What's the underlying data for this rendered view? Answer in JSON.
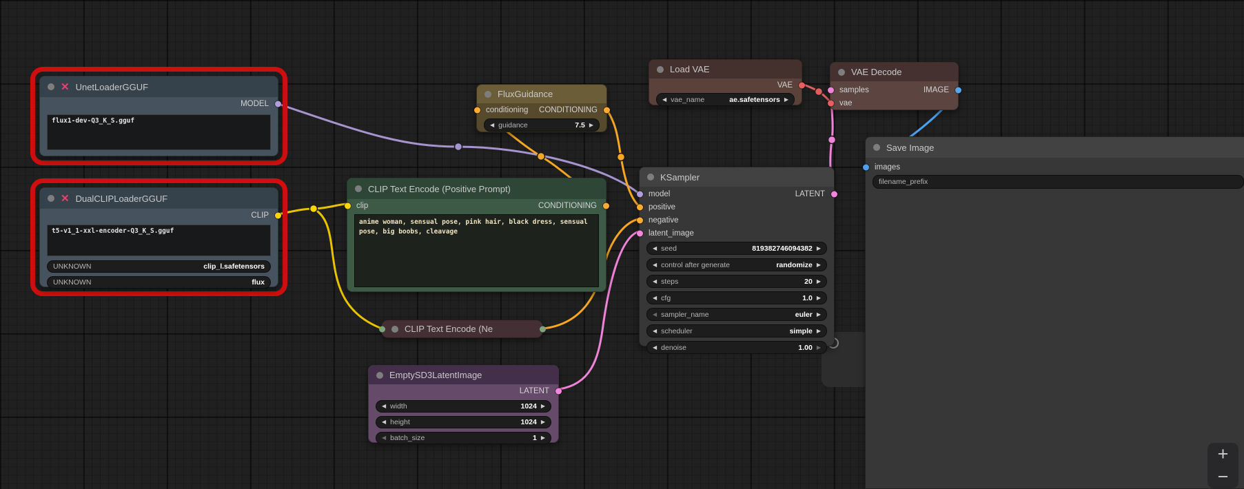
{
  "icons": {
    "left_arrow": "◀",
    "right_arrow": "▶",
    "close_x": "✕",
    "plus": "+",
    "minus": "−"
  },
  "colors": {
    "model": "#b39ddb",
    "clip": "#ffd500",
    "conditioning": "#ffab30",
    "latent": "#f584dd",
    "vae": "#e85f5f",
    "image": "#55a8f0",
    "error_outline": "#cf0f0f"
  },
  "nodes": {
    "unet_loader": {
      "title": "UnetLoaderGGUF",
      "output_label": "MODEL",
      "unet_name": "flux1-dev-Q3_K_S.gguf"
    },
    "dual_clip_loader": {
      "title": "DualCLIPLoaderGGUF",
      "output_label": "CLIP",
      "clip_name": "t5-v1_1-xxl-encoder-Q3_K_S.gguf",
      "widgets": [
        {
          "name": "UNKNOWN",
          "value": "clip_l.safetensors"
        },
        {
          "name": "UNKNOWN",
          "value": "flux"
        }
      ]
    },
    "clip_text_encode_positive": {
      "title": "CLIP Text Encode (Positive Prompt)",
      "input_label": "clip",
      "output_label": "CONDITIONING",
      "prompt": "anime woman, sensual pose, pink hair, black dress, sensual pose, big boobs, cleavage"
    },
    "flux_guidance": {
      "title": "FluxGuidance",
      "input_label": "conditioning",
      "output_label": "CONDITIONING",
      "widgets": [
        {
          "name": "guidance",
          "value": "7.5"
        }
      ]
    },
    "load_vae": {
      "title": "Load VAE",
      "output_label": "VAE",
      "widgets": [
        {
          "name": "vae_name",
          "value": "ae.safetensors"
        }
      ]
    },
    "vae_decode": {
      "title": "VAE Decode",
      "output_label": "IMAGE",
      "inputs": [
        {
          "label": "samples"
        },
        {
          "label": "vae"
        }
      ]
    },
    "ksampler": {
      "title": "KSampler",
      "output_label": "LATENT",
      "inputs": [
        {
          "label": "model"
        },
        {
          "label": "positive"
        },
        {
          "label": "negative"
        },
        {
          "label": "latent_image"
        }
      ],
      "widgets": [
        {
          "name": "seed",
          "value": "819382746094382"
        },
        {
          "name": "control after generate",
          "value": "randomize"
        },
        {
          "name": "steps",
          "value": "20"
        },
        {
          "name": "cfg",
          "value": "1.0"
        },
        {
          "name": "sampler_name",
          "value": "euler"
        },
        {
          "name": "scheduler",
          "value": "simple"
        },
        {
          "name": "denoise",
          "value": "1.00"
        }
      ]
    },
    "clip_text_encode_negative": {
      "title": "CLIP Text Encode (Ne"
    },
    "empty_sd3_latent_image": {
      "title": "EmptySD3LatentImage",
      "output_label": "LATENT",
      "widgets": [
        {
          "name": "width",
          "value": "1024"
        },
        {
          "name": "height",
          "value": "1024"
        },
        {
          "name": "batch_size",
          "value": "1"
        }
      ]
    },
    "save_image": {
      "title": "Save Image",
      "input_label": "images",
      "widgets": [
        {
          "name": "filename_prefix",
          "value": ""
        }
      ]
    }
  }
}
